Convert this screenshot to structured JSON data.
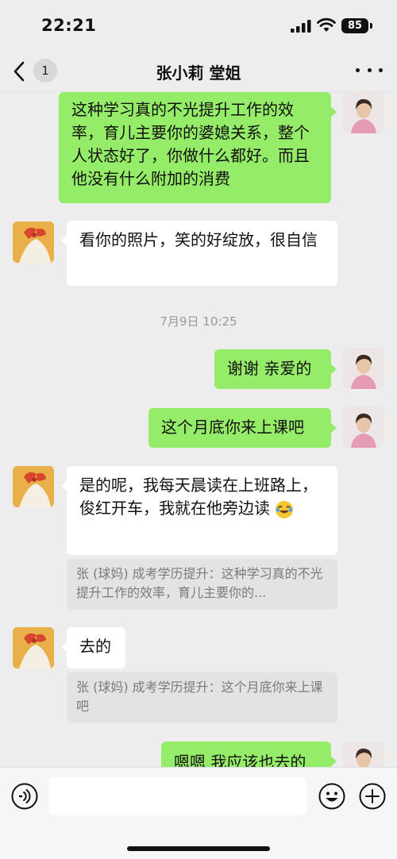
{
  "status_bar": {
    "time": "22:21",
    "battery": "85",
    "icons": [
      "signal-icon",
      "wifi-icon",
      "battery-icon"
    ]
  },
  "nav": {
    "back_icon": "chevron-left-icon",
    "unread_count": "1",
    "title": "张小莉 堂姐",
    "more_icon": "more-dots-icon"
  },
  "messages": [
    {
      "sender": "self",
      "text": "这种学习真的不光提升工作的效率，育儿主要你的婆媳关系，整个人状态好了，你做什么都好。而且他没有什么附加的消费"
    },
    {
      "sender": "friend",
      "text": "看你的照片，笑的好绽放，很自信"
    },
    {
      "type": "timestamp",
      "text": "7月9日 10:25"
    },
    {
      "sender": "self",
      "text": "谢谢 亲爱的"
    },
    {
      "sender": "self",
      "text": "这个月底你来上课吧"
    },
    {
      "sender": "friend",
      "text": "是的呢，我每天晨读在上班路上，俊红开车，我就在他旁边读",
      "emoji": "laughing-tears-emoji",
      "quote": "张 (球妈) 成考学历提升：这种学习真的不光提升工作的效率，育儿主要你的..."
    },
    {
      "sender": "friend",
      "text": "去的",
      "quote": "张 (球妈) 成考学历提升：这个月底你来上课吧"
    },
    {
      "sender": "self",
      "text": "嗯嗯 我应该也去的"
    }
  ],
  "input_bar": {
    "voice_icon": "voice-icon",
    "emoji_icon": "emoji-icon",
    "plus_icon": "plus-icon"
  },
  "colors": {
    "background": "#ededed",
    "outgoing_bubble": "#95ec69",
    "incoming_bubble": "#ffffff"
  }
}
